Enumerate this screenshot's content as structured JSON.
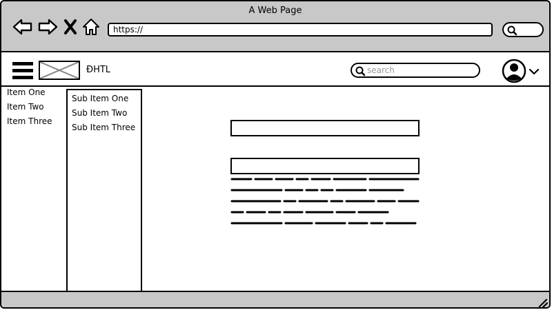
{
  "window": {
    "title": "A Web Page"
  },
  "toolbar": {
    "url": "https://"
  },
  "header": {
    "brand": "ĐHTL",
    "search_placeholder": "search"
  },
  "menu": {
    "items": [
      "Item One",
      "Item Two",
      "Item Three"
    ]
  },
  "submenu": {
    "items": [
      "Sub Item One",
      "Sub Item Two",
      "Sub Item Three"
    ]
  },
  "icons": {
    "back": "arrow-left-icon",
    "forward": "arrow-right-icon",
    "stop": "close-icon",
    "home": "home-icon",
    "menu": "hamburger-icon",
    "search": "search-icon",
    "user": "user-icon",
    "dropdown": "chevron-down-icon",
    "resize": "resize-handle-icon"
  }
}
